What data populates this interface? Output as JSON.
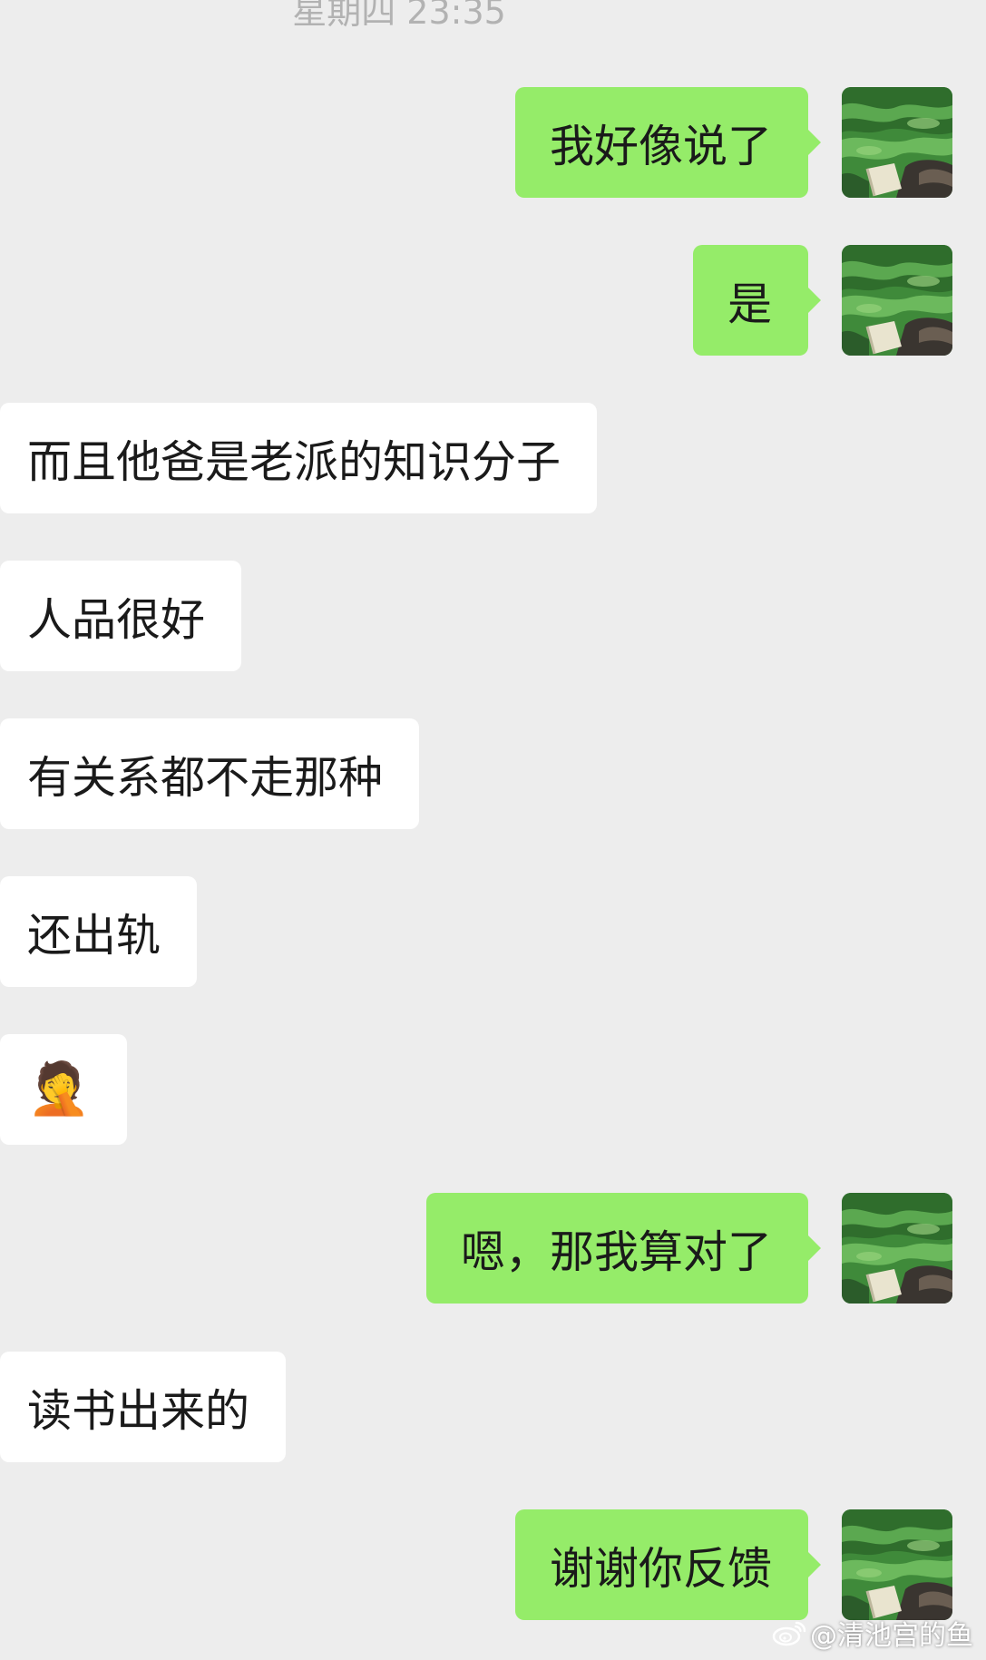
{
  "chat": {
    "timestamp": "星期四 23:35",
    "messages": [
      {
        "side": "sent",
        "text": "我好像说了"
      },
      {
        "side": "sent",
        "text": "是"
      },
      {
        "side": "received",
        "text": "而且他爸是老派的知识分子"
      },
      {
        "side": "received",
        "text": "人品很好"
      },
      {
        "side": "received",
        "text": "有关系都不走那种"
      },
      {
        "side": "received",
        "text": "还出轨"
      },
      {
        "side": "received",
        "text": "🤦",
        "emoji": "face-palm-emoji"
      },
      {
        "side": "sent",
        "text": "嗯，那我算对了"
      },
      {
        "side": "received",
        "text": "读书出来的"
      },
      {
        "side": "sent",
        "text": "谢谢你反馈"
      }
    ]
  },
  "colors": {
    "background": "#ededed",
    "sent_bubble": "#95ec69",
    "received_bubble": "#ffffff",
    "timestamp_text": "#b2b2b2"
  },
  "watermark": {
    "icon": "weibo-icon",
    "text": "@清池宫的鱼"
  }
}
